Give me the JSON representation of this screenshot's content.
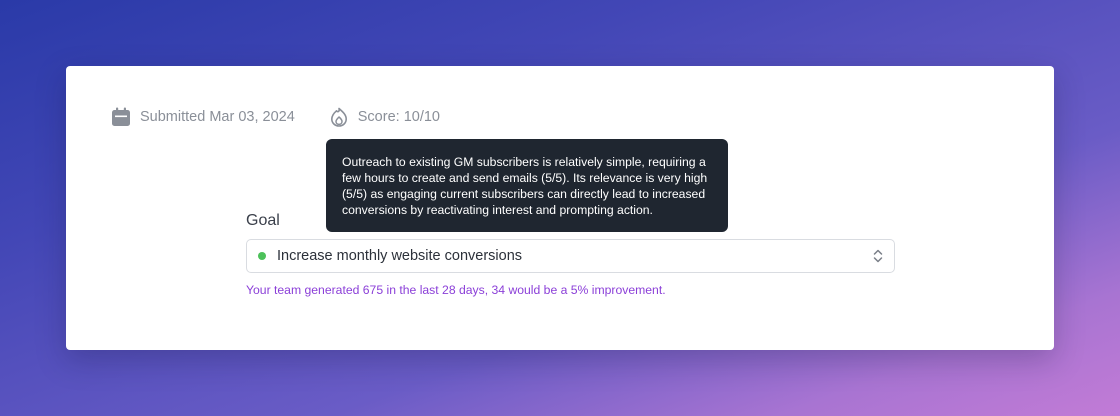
{
  "meta": {
    "submitted_label": "Submitted Mar 03, 2024",
    "score_label": "Score: 10/10",
    "calendar_icon": "calendar-icon",
    "score_icon": "fire-icon"
  },
  "tooltip": {
    "text": "Outreach to existing GM subscribers is relatively simple, requiring a few hours to create and send emails (5/5). Its relevance is very high (5/5) as engaging current subscribers can directly lead to increased conversions by reactivating interest and prompting action."
  },
  "goal": {
    "label": "Goal",
    "selected_value": "Increase monthly website conversions",
    "status_color": "#4cc15a",
    "helper_text": "Your team generated 675 in the last 28 days, 34 would be a 5% improvement."
  },
  "colors": {
    "helper_text": "#8b3fd8",
    "tooltip_bg": "#1f2630"
  }
}
